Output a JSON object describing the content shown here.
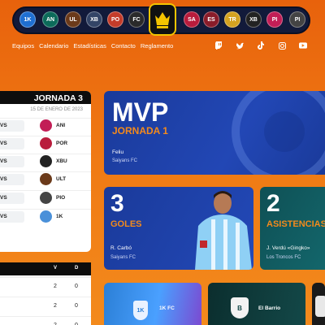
{
  "teams_bar": [
    {
      "abbr": "1K",
      "color": "#1f6fd1"
    },
    {
      "abbr": "AN",
      "color": "#0c6b5a"
    },
    {
      "abbr": "UL",
      "color": "#6b3a1a"
    },
    {
      "abbr": "XB",
      "color": "#334466"
    },
    {
      "abbr": "PO",
      "color": "#c43c2a"
    },
    {
      "abbr": "FC",
      "color": "#2a2a2a"
    },
    {
      "abbr": "SA",
      "color": "#b91c3c"
    },
    {
      "abbr": "ES",
      "color": "#8a1c2a"
    },
    {
      "abbr": "TR",
      "color": "#d4a220"
    },
    {
      "abbr": "XB",
      "color": "#222"
    },
    {
      "abbr": "PI",
      "color": "#c21e56"
    },
    {
      "abbr": "PI",
      "color": "#444"
    }
  ],
  "nav": {
    "items": [
      "Equipos",
      "Calendario",
      "Estadísticas",
      "Contacto",
      "Reglamento"
    ]
  },
  "socials": [
    "twitch-icon",
    "twitter-icon",
    "tiktok-icon",
    "instagram-icon",
    "youtube-icon"
  ],
  "jornada": {
    "title": "JORNADA 3",
    "date": "15 DE ENERO DE 2023",
    "matches": [
      {
        "vs": "VS",
        "abbr": "ANI",
        "color": "#c21e56"
      },
      {
        "vs": "VS",
        "abbr": "POR",
        "color": "#b91c3c"
      },
      {
        "vs": "VS",
        "abbr": "XBU",
        "color": "#222222"
      },
      {
        "vs": "VS",
        "abbr": "ULT",
        "color": "#6b3a1a"
      },
      {
        "vs": "VS",
        "abbr": "PIO",
        "color": "#444444"
      },
      {
        "vs": "VS",
        "abbr": "1K",
        "color": "#4a90d9"
      }
    ]
  },
  "table": {
    "col_v": "V",
    "col_d": "D",
    "rows": [
      {
        "v": "2",
        "d": "0"
      },
      {
        "v": "2",
        "d": "0"
      },
      {
        "v": "2",
        "d": "0"
      }
    ]
  },
  "mvp": {
    "title": "MVP",
    "subtitle": "JORNADA 1",
    "player": "Feliu",
    "team": "Saiyans FC"
  },
  "goals": {
    "number": "3",
    "label": "GOLES",
    "player": "R. Carbó",
    "team": "Saiyans FC"
  },
  "assists": {
    "number": "2",
    "label": "ASISTENCIAS",
    "player": "J. Verdú «Gingko»",
    "team": "Los Troncos FC"
  },
  "team_cards": [
    {
      "name": "1K FC",
      "color": "#2b7fd6"
    },
    {
      "name": "El Barrio",
      "color": "#0f3a3a"
    },
    {
      "name": "",
      "color": "#1a1a1a"
    }
  ]
}
